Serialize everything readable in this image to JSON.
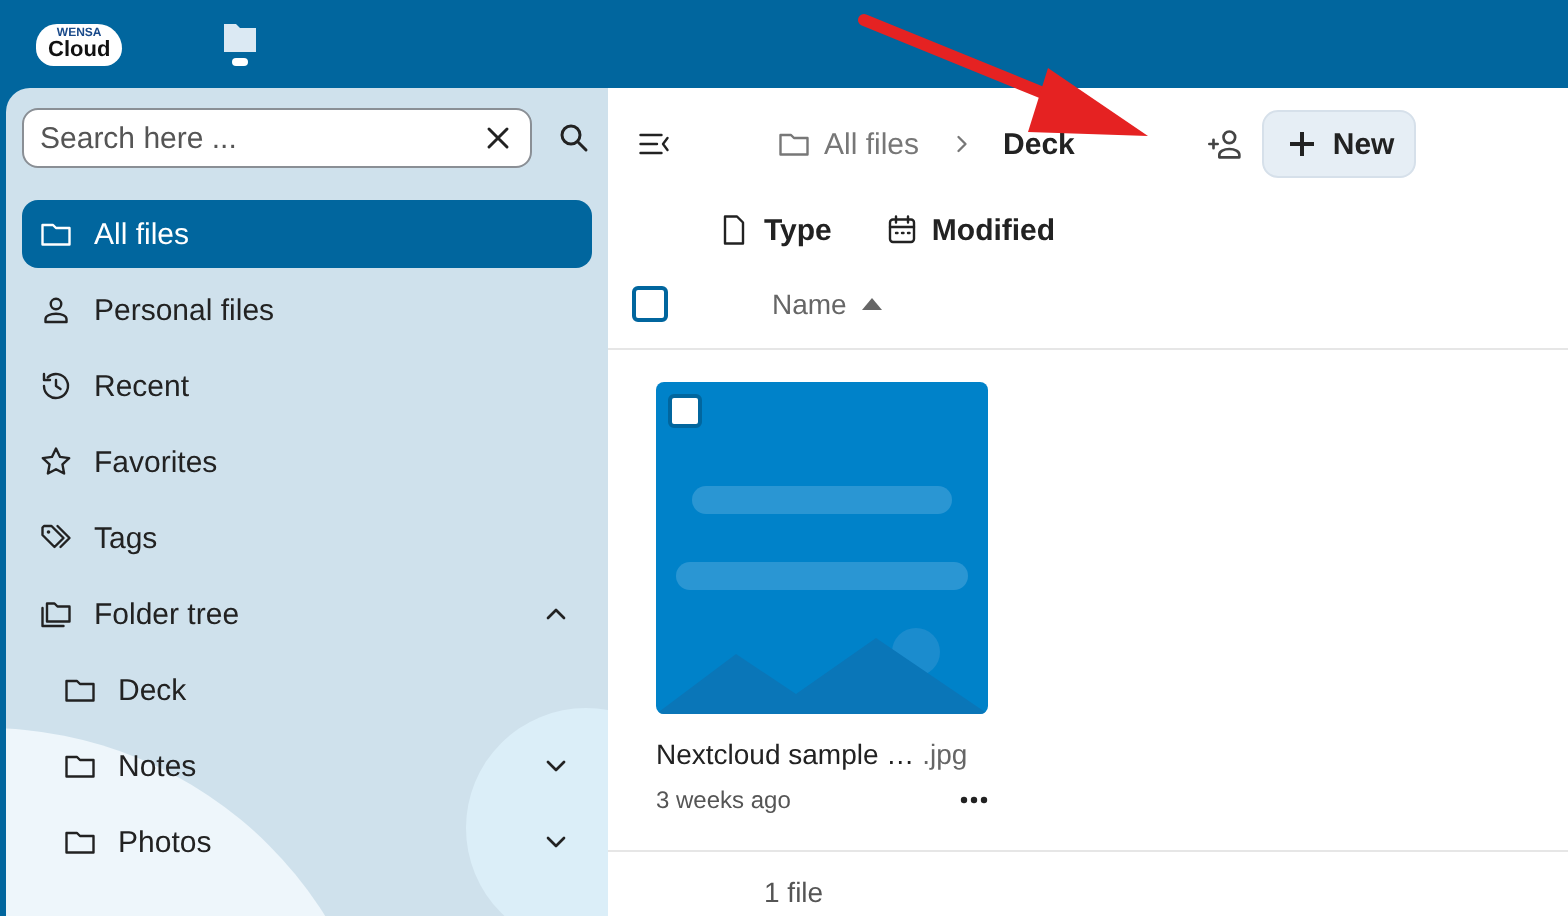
{
  "header": {
    "logo": {
      "top": "WENSA",
      "main": "Cloud"
    }
  },
  "search": {
    "placeholder": "Search here ..."
  },
  "sidebar": {
    "items": [
      {
        "label": "All files",
        "selected": true
      },
      {
        "label": "Personal files",
        "selected": false
      },
      {
        "label": "Recent",
        "selected": false
      },
      {
        "label": "Favorites",
        "selected": false
      },
      {
        "label": "Tags",
        "selected": false
      },
      {
        "label": "Folder tree",
        "selected": false,
        "expanded": true,
        "children": [
          {
            "label": "Deck",
            "selected": false,
            "expandable": false
          },
          {
            "label": "Notes",
            "selected": false,
            "expandable": true
          },
          {
            "label": "Photos",
            "selected": false,
            "expandable": true
          }
        ]
      }
    ]
  },
  "breadcrumbs": [
    {
      "label": "All files",
      "current": false
    },
    {
      "label": "Deck",
      "current": true
    }
  ],
  "new_button": "New",
  "filters": [
    "Type",
    "Modified"
  ],
  "table": {
    "select_all": false,
    "columns": [
      {
        "label": "Name",
        "sort_ascending": true
      }
    ]
  },
  "files": [
    {
      "name": "Nextcloud sample … ",
      "extension": ".jpg",
      "modified": "3 weeks ago",
      "selected": false
    }
  ],
  "summary": "1 file"
}
